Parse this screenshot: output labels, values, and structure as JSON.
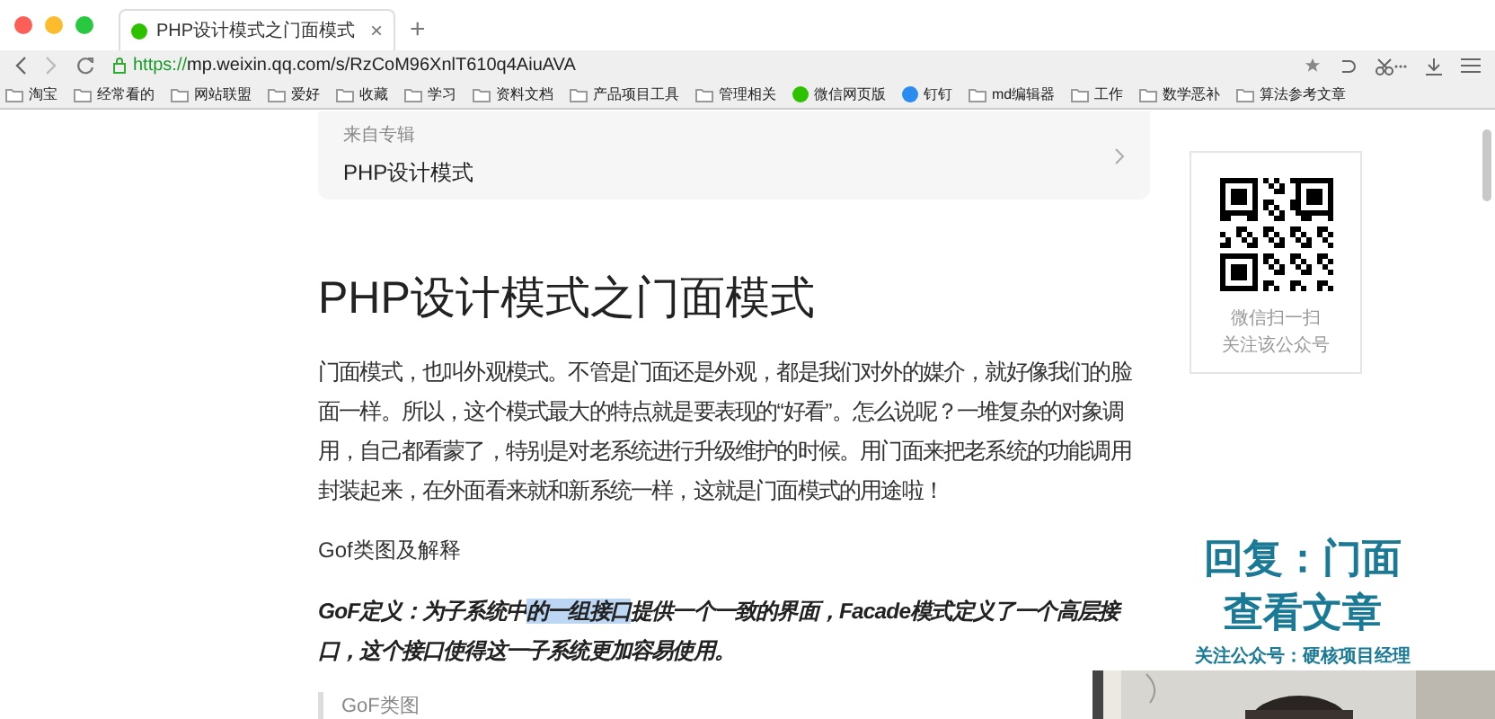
{
  "tab": {
    "title": "PHP设计模式之门面模式",
    "close": "×",
    "new_tab": "+"
  },
  "address_bar": {
    "scheme": "https://",
    "url": "mp.weixin.qq.com/s/RzCoM96XnlT610q4AiuAVA"
  },
  "bookmarks": [
    {
      "label": "淘宝",
      "kind": "folder"
    },
    {
      "label": "经常看的",
      "kind": "folder"
    },
    {
      "label": "网站联盟",
      "kind": "folder"
    },
    {
      "label": "爱好",
      "kind": "folder"
    },
    {
      "label": "收藏",
      "kind": "folder"
    },
    {
      "label": "学习",
      "kind": "folder"
    },
    {
      "label": "资料文档",
      "kind": "folder"
    },
    {
      "label": "产品项目工具",
      "kind": "folder"
    },
    {
      "label": "管理相关",
      "kind": "folder"
    },
    {
      "label": "微信网页版",
      "kind": "wechat"
    },
    {
      "label": "钉钉",
      "kind": "dingtalk"
    },
    {
      "label": "md编辑器",
      "kind": "folder"
    },
    {
      "label": "工作",
      "kind": "folder"
    },
    {
      "label": "数学恶补",
      "kind": "folder"
    },
    {
      "label": "算法参考文章",
      "kind": "folder"
    }
  ],
  "album": {
    "caption": "来自专辑",
    "name": "PHP设计模式"
  },
  "article": {
    "title": "PHP设计模式之门面模式",
    "intro": "门面模式，也叫外观模式。不管是门面还是外观，都是我们对外的媒介，就好像我们的脸面一样。所以，这个模式最大的特点就是要表现的“好看”。怎么说呢？一堆复杂的对象调用，自己都看蒙了，特别是对老系统进行升级维护的时候。用门面来把老系统的功能调用封装起来，在外面看来就和新系统一样，这就是门面模式的用途啦！",
    "heading": "Gof类图及解释",
    "definition": [
      {
        "text": "GoF定义：为子系统中",
        "selected": false
      },
      {
        "text": "的一组接口",
        "selected": true
      },
      {
        "text": "提供一个一致的界面，Facade模式定义了一个高层接口，这个接口使得这一子系统更加容易使用。",
        "selected": false
      }
    ],
    "quote": "GoF类图"
  },
  "qr_panel": {
    "lines": [
      "微信扫一扫",
      "关注该公众号"
    ]
  },
  "overlay": {
    "lines": [
      "回复：门面",
      "查看文章"
    ],
    "note": "关注公众号：硬核项目经理"
  }
}
